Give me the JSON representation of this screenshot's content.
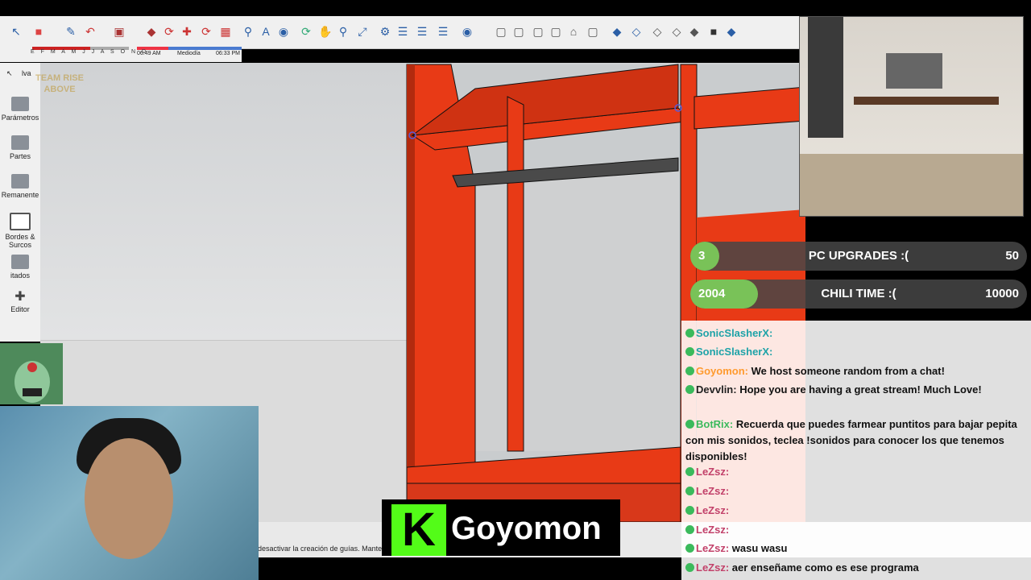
{
  "sidebar": {
    "items": [
      {
        "label": "lva"
      },
      {
        "label": "Parámetros"
      },
      {
        "label": "Partes"
      },
      {
        "label": "Remanente"
      },
      {
        "label": "Bordes & Surcos"
      },
      {
        "label": "itados"
      },
      {
        "label": "Editor"
      }
    ]
  },
  "timeline": {
    "months": "E F M A M J J A S O N D",
    "time_start": "06:49 AM",
    "time_mid": "Mediodía",
    "time_end": "06:33 PM"
  },
  "statusbar": {
    "text": "desactivar la creación de guías. Mantene"
  },
  "goals": [
    {
      "start": "3",
      "name": "PC UPGRADES :(",
      "end": "50",
      "progress": 0.06
    },
    {
      "start": "2004",
      "name": "CHILI TIME :(",
      "end": "10000",
      "progress": 0.2
    }
  ],
  "chat": [
    {
      "user": "SonicSlasherX:",
      "text": "",
      "color": "#1fa3a8"
    },
    {
      "user": "SonicSlasherX:",
      "text": "",
      "color": "#1fa3a8"
    },
    {
      "user": "Goyomon:",
      "text": "We host someone random from a chat!",
      "color": "#ff9a2e"
    },
    {
      "user": "Devvlin:",
      "text": "Hope you are having a great stream! Much Love!",
      "color": "#222"
    },
    {
      "user": "BotRix:",
      "text": "Recuerda que puedes farmear puntitos para bajar pepita con mis sonidos, teclea !sonidos para conocer los que tenemos disponibles!",
      "color": "#3bba5c"
    },
    {
      "user": "LeZsz:",
      "text": "",
      "color": "#c2416a"
    },
    {
      "user": "LeZsz:",
      "text": "",
      "color": "#c2416a"
    },
    {
      "user": "LeZsz:",
      "text": "",
      "color": "#c2416a"
    },
    {
      "user": "LeZsz:",
      "text": "",
      "color": "#c2416a"
    },
    {
      "user": "LeZsz:",
      "text": "wasu wasu",
      "color": "#c2416a"
    },
    {
      "user": "LeZsz:",
      "text": "aer enseñame como es ese programa",
      "color": "#c2416a"
    }
  ],
  "kick": {
    "name": "Goyomon",
    "logo_letter": "K"
  },
  "logo": {
    "text": "TEAM RISE ABOVE"
  },
  "colors": {
    "furniture": "#e83a16",
    "rod": "#4a4a4a",
    "kick_green": "#53fc18",
    "goal_green": "#79c258"
  }
}
